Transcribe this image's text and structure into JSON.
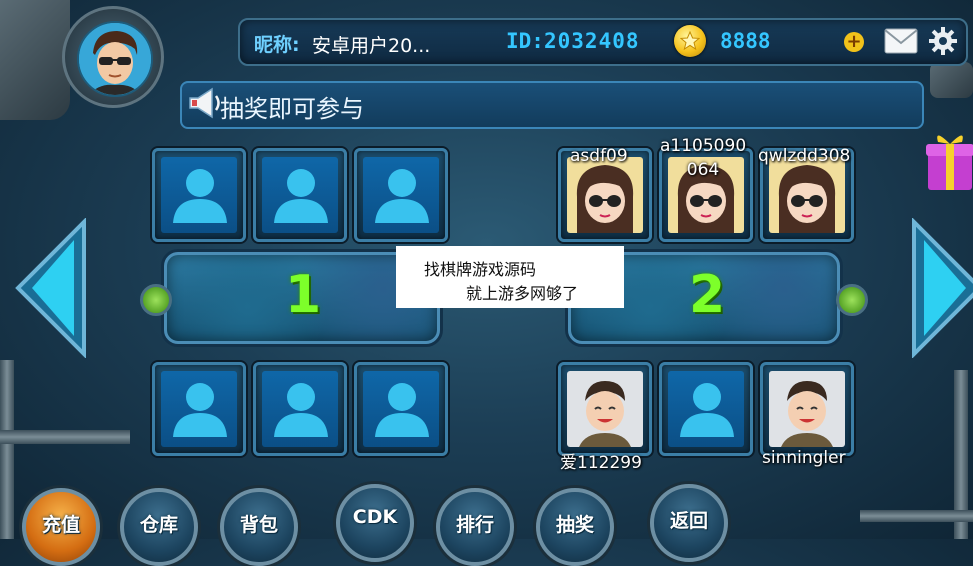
{
  "header": {
    "nickname_label": "昵称:",
    "nickname": "安卓用户20...",
    "id_label": "ID:",
    "id_value": "2032408",
    "coins": "8888"
  },
  "announcement": {
    "text": "抽奖即可参与"
  },
  "tables": [
    {
      "number": "1",
      "top_seats": [
        {
          "occupied": false
        },
        {
          "occupied": false
        },
        {
          "occupied": false
        }
      ],
      "bottom_seats": [
        {
          "occupied": false
        },
        {
          "occupied": false
        },
        {
          "occupied": false
        }
      ]
    },
    {
      "number": "2",
      "top_seats": [
        {
          "occupied": true,
          "name": "asdf09"
        },
        {
          "occupied": true,
          "name": "a1105090\n064"
        },
        {
          "occupied": true,
          "name": "qwlzdd308"
        }
      ],
      "bottom_seats": [
        {
          "occupied": true,
          "name": "爱112299"
        },
        {
          "occupied": false
        },
        {
          "occupied": true,
          "name": "sinningler"
        }
      ]
    }
  ],
  "watermark": {
    "line1": "找棋牌游戏源码",
    "line2": "就上游多网够了"
  },
  "bottom_buttons": [
    {
      "label": "充值"
    },
    {
      "label": "仓库"
    },
    {
      "label": "背包"
    },
    {
      "label": "CDK"
    },
    {
      "label": "排行"
    },
    {
      "label": "抽奖"
    },
    {
      "label": "返回"
    }
  ],
  "colors": {
    "accent": "#34c6ff",
    "table_number": "#7dff2a",
    "seat_blue": "#0f67a8"
  },
  "icons": [
    "mail-icon",
    "gear-icon",
    "coin-icon",
    "plus-icon",
    "speaker-icon",
    "gift-icon",
    "left-arrow-icon",
    "right-arrow-icon",
    "person-icon"
  ]
}
